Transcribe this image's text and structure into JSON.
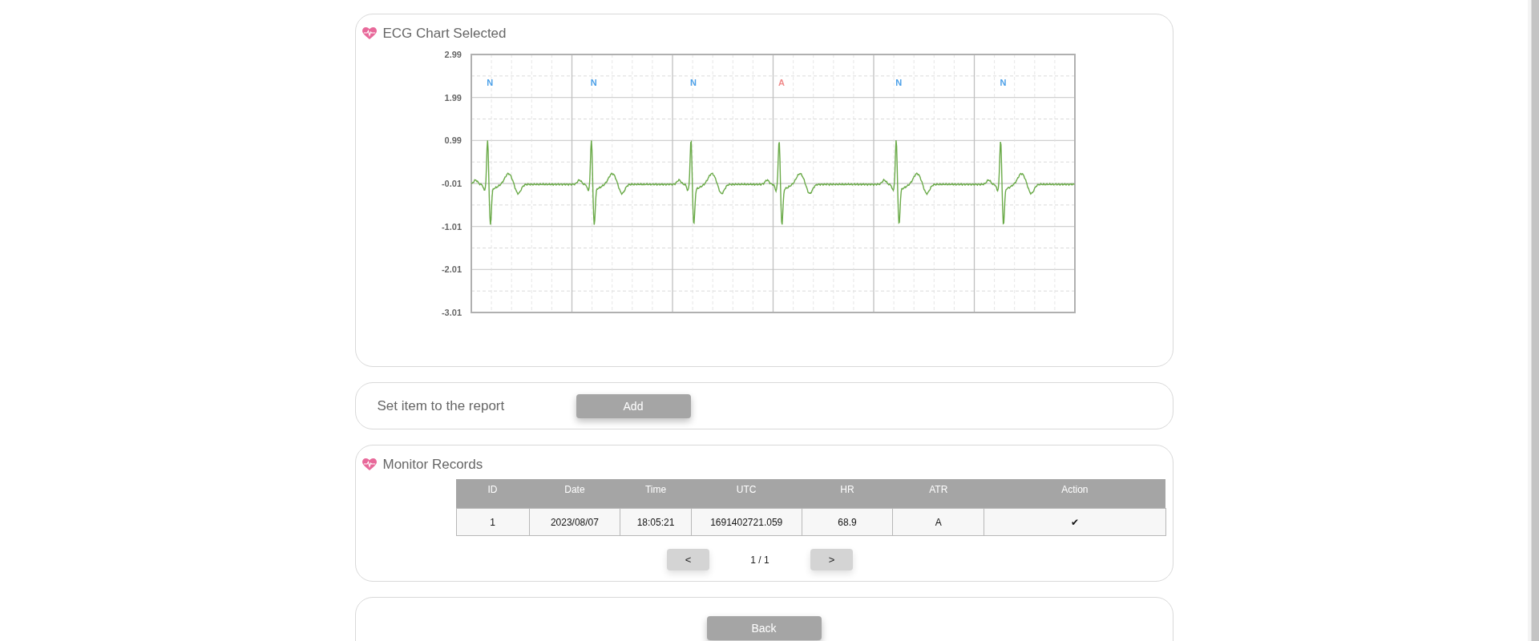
{
  "ecg_panel": {
    "title": "ECG Chart Selected",
    "y_labels": [
      "2.99",
      "1.99",
      "0.99",
      "-0.01",
      "-1.01",
      "-2.01",
      "-3.01"
    ],
    "beats": [
      {
        "label": "N",
        "color": "#4a9fe8"
      },
      {
        "label": "N",
        "color": "#4a9fe8"
      },
      {
        "label": "N",
        "color": "#4a9fe8"
      },
      {
        "label": "A",
        "color": "#f08a8a"
      },
      {
        "label": "N",
        "color": "#4a9fe8"
      },
      {
        "label": "N",
        "color": "#4a9fe8"
      }
    ]
  },
  "report_panel": {
    "label": "Set item to the report",
    "button": "Add"
  },
  "records_panel": {
    "title": "Monitor Records",
    "table": {
      "columns": [
        "ID",
        "Date",
        "Time",
        "UTC",
        "HR",
        "ATR",
        "Action"
      ],
      "rows": [
        [
          "1",
          "2023/08/07",
          "18:05:21",
          "1691402721.059",
          "68.9",
          "A",
          "✔"
        ]
      ]
    },
    "pagination": {
      "prev": "<",
      "page": "1 / 1",
      "next": ">"
    }
  },
  "footer": {
    "button": "Back"
  }
}
